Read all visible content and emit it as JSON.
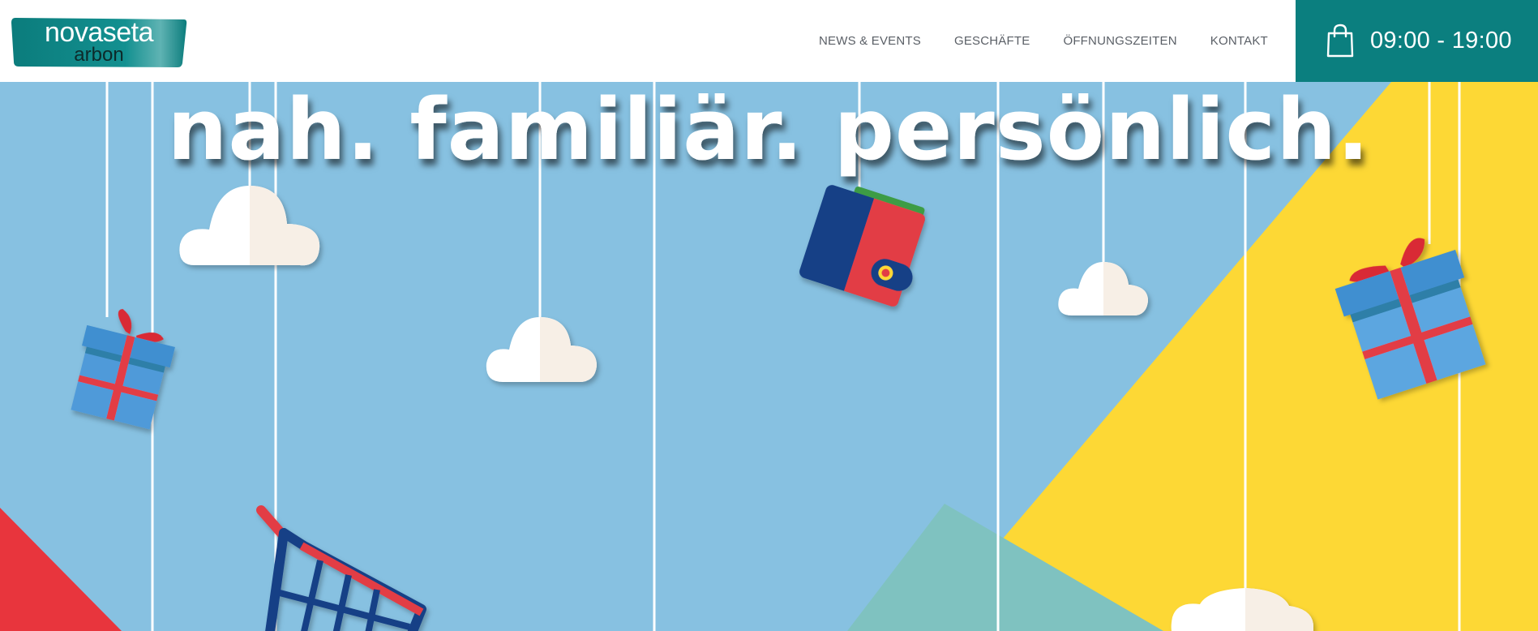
{
  "logo": {
    "main": "novaseta",
    "sub": "arbon"
  },
  "nav": {
    "items": [
      {
        "label": "NEWS & EVENTS"
      },
      {
        "label": "GESCHÄFTE"
      },
      {
        "label": "ÖFFNUNGSZEITEN"
      },
      {
        "label": "KONTAKT"
      }
    ]
  },
  "hours": {
    "icon": "shopping-bag-icon",
    "text": "09:00 - 19:00"
  },
  "hero": {
    "tagline": "nah. familiär. persönlich."
  },
  "colors": {
    "brand_teal": "#0b7f7f",
    "hero_blue": "#87c1e1",
    "accent_yellow": "#fdd835",
    "accent_red": "#e8353d",
    "accent_green": "#7fc2c0"
  }
}
